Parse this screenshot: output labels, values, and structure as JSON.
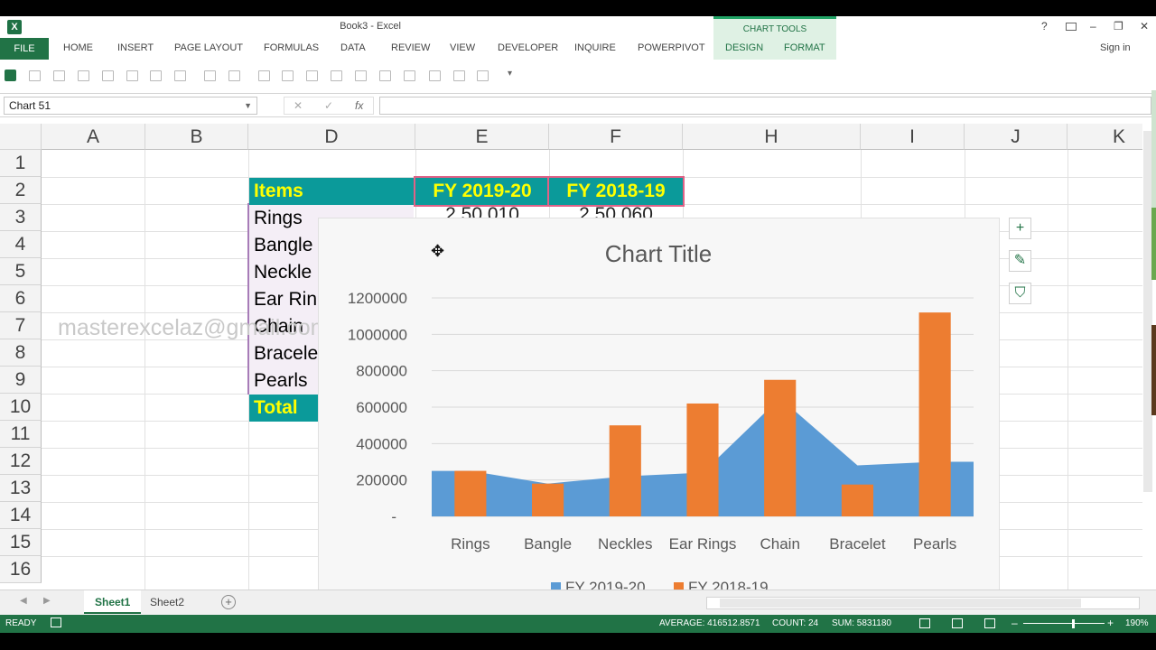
{
  "window": {
    "title": "Book3 - Excel",
    "help": "?",
    "minimize": "–",
    "restore": "❐",
    "close": "✕"
  },
  "chart_tools": {
    "label": "CHART TOOLS"
  },
  "ribbon": {
    "tabs": [
      "FILE",
      "HOME",
      "INSERT",
      "PAGE LAYOUT",
      "FORMULAS",
      "DATA",
      "REVIEW",
      "VIEW",
      "DEVELOPER",
      "INQUIRE",
      "POWERPIVOT"
    ],
    "chart_tabs": [
      "DESIGN",
      "FORMAT"
    ],
    "signin": "Sign in"
  },
  "formula_bar": {
    "name_box": "Chart 51",
    "cancel": "✕",
    "enter": "✓",
    "fx": "fx",
    "formula": ""
  },
  "columns": [
    "A",
    "B",
    "D",
    "E",
    "F",
    "H",
    "I",
    "J",
    "K"
  ],
  "rows": [
    "1",
    "2",
    "3",
    "4",
    "5",
    "6",
    "7",
    "8",
    "9",
    "10",
    "11",
    "12",
    "13",
    "14",
    "15",
    "16"
  ],
  "table": {
    "header": {
      "items": "Items",
      "fy1": "FY 2019-20",
      "fy2": "FY 2018-19"
    },
    "items": [
      "Rings",
      "Bangle",
      "Neckle",
      "Ear Rin",
      "Chain",
      "Bracele",
      "Pearls"
    ],
    "partial_values": [
      "2,50,010",
      "2,50,060"
    ],
    "total": "Total"
  },
  "watermark": "masterexcelaz@gmail.com",
  "chart_data": {
    "type": "bar",
    "title": "Chart Title",
    "categories": [
      "Rings",
      "Bangle",
      "Neckles",
      "Ear Rings",
      "Chain",
      "Bracelet",
      "Pearls"
    ],
    "ylim": [
      0,
      1200000
    ],
    "yticks": [
      "-",
      "200000",
      "400000",
      "600000",
      "800000",
      "1000000",
      "1200000"
    ],
    "grid": true,
    "legend_position": "bottom",
    "series": [
      {
        "name": "FY 2019-20",
        "type": "area",
        "color": "#5b9bd5",
        "values": [
          250010,
          180000,
          220000,
          240000,
          650000,
          280000,
          300000
        ]
      },
      {
        "name": "FY 2018-19",
        "type": "bar",
        "color": "#ed7d31",
        "values": [
          250060,
          180000,
          500000,
          620000,
          750000,
          175000,
          1120000
        ]
      }
    ]
  },
  "sheets": {
    "tabs": [
      "Sheet1",
      "Sheet2"
    ],
    "add": "+"
  },
  "status": {
    "ready": "READY",
    "average": "AVERAGE: 416512.8571",
    "count": "COUNT: 24",
    "sum": "SUM: 5831180",
    "zoom": "190%"
  }
}
